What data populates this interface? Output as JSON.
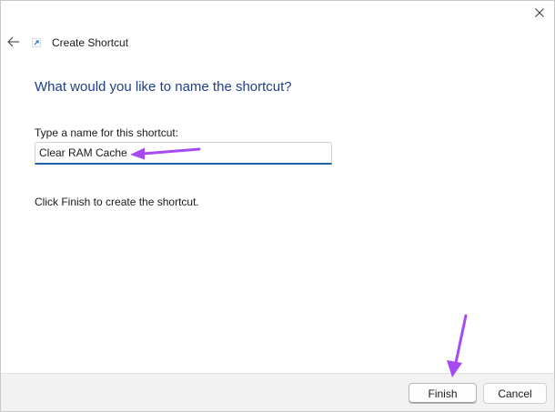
{
  "window": {
    "title": "Create Shortcut"
  },
  "icons": {
    "close": "close-icon",
    "back": "back-arrow-icon",
    "app": "shortcut-icon"
  },
  "main": {
    "heading": "What would you like to name the shortcut?",
    "field_label": "Type a name for this shortcut:",
    "field_value": "Clear RAM Cache",
    "hint": "Click Finish to create the shortcut."
  },
  "footer": {
    "finish_label": "Finish",
    "cancel_label": "Cancel"
  },
  "colors": {
    "heading": "#1f3f86",
    "input_underline": "#1f5fa8",
    "annotation_arrow": "#a64bf4"
  }
}
